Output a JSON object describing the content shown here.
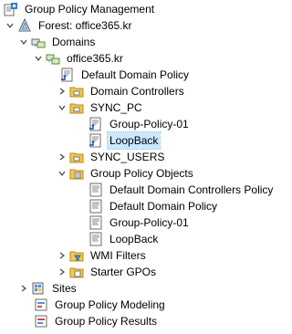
{
  "tree": {
    "root": "Group Policy Management",
    "forest": "Forest: office365.kr",
    "domains": "Domains",
    "domain": "office365.kr",
    "default_domain_policy": "Default Domain Policy",
    "domain_controllers": "Domain Controllers",
    "sync_pc": "SYNC_PC",
    "gpo1_link": "Group-Policy-01",
    "loopback_link": "LoopBack",
    "sync_users": "SYNC_USERS",
    "gpo_container": "Group Policy Objects",
    "gpo_ddcp": "Default Domain Controllers Policy",
    "gpo_ddp": "Default Domain Policy",
    "gpo_gp01": "Group-Policy-01",
    "gpo_loopback": "LoopBack",
    "wmi_filters": "WMI Filters",
    "starter_gpos": "Starter GPOs",
    "sites": "Sites",
    "modeling": "Group Policy Modeling",
    "results": "Group Policy Results"
  },
  "selected_item": "loopback_link"
}
